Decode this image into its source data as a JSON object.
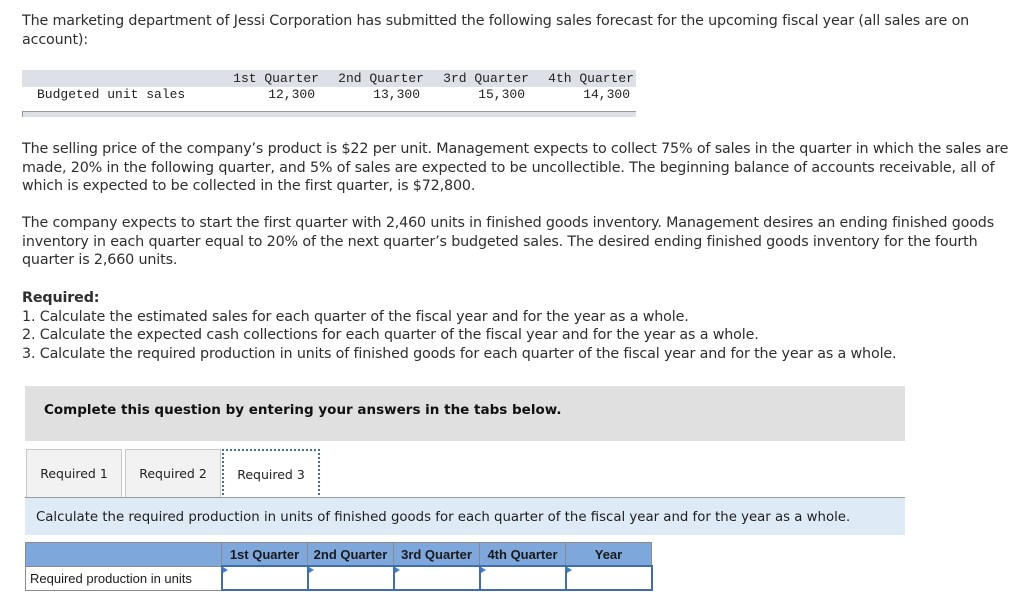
{
  "intro_text": "The marketing department of Jessi Corporation has submitted the following sales forecast for the upcoming fiscal year (all sales are on account):",
  "forecast_table": {
    "columns": [
      "1st Quarter",
      "2nd Quarter",
      "3rd Quarter",
      "4th Quarter"
    ],
    "row_label": "Budgeted unit sales",
    "values": [
      "12,300",
      "13,300",
      "15,300",
      "14,300"
    ]
  },
  "price_text": "The selling price of the company’s product is $22 per unit. Management expects to collect 75% of sales in the quarter in which the sales are made, 20% in the following quarter, and 5% of sales are expected to be uncollectible. The beginning balance of accounts receivable, all of which is expected to be collected in the first quarter, is $72,800.",
  "inventory_text": "The company expects to start the first quarter with 2,460 units in finished goods inventory. Management desires an ending finished goods inventory in each quarter equal to 20% of the next quarter’s budgeted sales. The desired ending finished goods inventory for the fourth quarter is 2,660 units.",
  "required": {
    "heading": "Required:",
    "items": [
      "1. Calculate the estimated sales for each quarter of the fiscal year and for the year as a whole.",
      "2. Calculate the expected cash collections for each quarter of the fiscal year and for the year as a whole.",
      "3. Calculate the required production in units of finished goods for each quarter of the fiscal year and for the year as a whole."
    ]
  },
  "instruction": "Complete this question by entering your answers in the tabs below.",
  "tabs": [
    {
      "label": "Required 1",
      "active": false
    },
    {
      "label": "Required 2",
      "active": false
    },
    {
      "label": "Required 3",
      "active": true
    }
  ],
  "task_text": "Calculate the required production in units of finished goods for each quarter of the fiscal year and for the year as a whole.",
  "answer_table": {
    "columns": [
      "",
      "1st Quarter",
      "2nd Quarter",
      "3rd Quarter",
      "4th Quarter",
      "Year"
    ],
    "rows": [
      {
        "label": "Required production in units",
        "values": [
          "",
          "",
          "",
          "",
          ""
        ]
      }
    ]
  },
  "colors": {
    "tab_focus_border": "#3a6fb0",
    "answer_header_bg": "#7ea7dc",
    "task_bar_bg": "#dfeaf7",
    "instruction_bg": "#e0e0e0"
  }
}
